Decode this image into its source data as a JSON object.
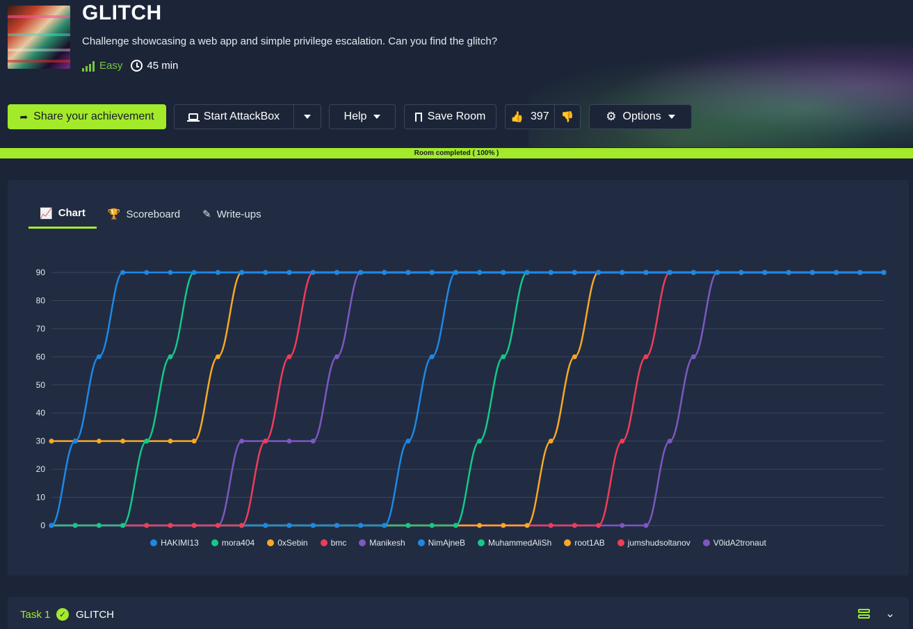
{
  "room": {
    "title": "GLITCH",
    "description": "Challenge showcasing a web app and simple privilege escalation. Can you find the glitch?",
    "difficulty": "Easy",
    "duration": "45 min"
  },
  "toolbar": {
    "share_label": "Share your achievement",
    "attackbox_label": "Start AttackBox",
    "help_label": "Help",
    "save_label": "Save Room",
    "likes": "397",
    "options_label": "Options"
  },
  "progress": {
    "label": "Room completed ( 100% )",
    "percent": 100
  },
  "tabs": [
    {
      "label": "Chart",
      "active": true,
      "icon": "chart-line-icon"
    },
    {
      "label": "Scoreboard",
      "active": false,
      "icon": "trophy-icon"
    },
    {
      "label": "Write-ups",
      "active": false,
      "icon": "pencil-icon"
    }
  ],
  "chart_data": {
    "type": "line",
    "title": "",
    "xlabel": "",
    "ylabel": "",
    "ylim": [
      0,
      90
    ],
    "yticks": [
      0,
      10,
      20,
      30,
      40,
      50,
      60,
      70,
      80,
      90
    ],
    "x": [
      0,
      1,
      2,
      3,
      4,
      5,
      6,
      7,
      8,
      9,
      10,
      11,
      12,
      13,
      14,
      15,
      16,
      17,
      18,
      19,
      20,
      21,
      22,
      23,
      24,
      25,
      26,
      27,
      28,
      29,
      30,
      31,
      32,
      33,
      34,
      35
    ],
    "series": [
      {
        "name": "HAKIMI13",
        "color": "#1e88e5",
        "values": [
          0,
          30,
          60,
          90,
          90,
          90,
          90,
          90,
          90,
          90,
          90,
          90,
          90,
          90,
          90,
          90,
          90,
          90,
          90,
          90,
          90,
          90,
          90,
          90,
          90,
          90,
          90,
          90,
          90,
          90,
          90,
          90,
          90,
          90,
          90,
          90
        ]
      },
      {
        "name": "mora404",
        "color": "#13c98a",
        "values": [
          0,
          0,
          0,
          0,
          30,
          60,
          90,
          90,
          90,
          90,
          90,
          90,
          90,
          90,
          90,
          90,
          90,
          90,
          90,
          90,
          90,
          90,
          90,
          90,
          90,
          90,
          90,
          90,
          90,
          90,
          90,
          90,
          90,
          90,
          90,
          90
        ]
      },
      {
        "name": "0xSebin",
        "color": "#f9a825",
        "values": [
          30,
          30,
          30,
          30,
          30,
          30,
          30,
          60,
          90,
          90,
          90,
          90,
          90,
          90,
          90,
          90,
          90,
          90,
          90,
          90,
          90,
          90,
          90,
          90,
          90,
          90,
          90,
          90,
          90,
          90,
          90,
          90,
          90,
          90,
          90,
          90
        ]
      },
      {
        "name": "bmc",
        "color": "#ef3d59",
        "values": [
          0,
          0,
          0,
          0,
          0,
          0,
          0,
          0,
          0,
          30,
          60,
          90,
          90,
          90,
          90,
          90,
          90,
          90,
          90,
          90,
          90,
          90,
          90,
          90,
          90,
          90,
          90,
          90,
          90,
          90,
          90,
          90,
          90,
          90,
          90,
          90
        ]
      },
      {
        "name": "Manikesh",
        "color": "#7e57c2",
        "values": [
          0,
          0,
          0,
          0,
          0,
          0,
          0,
          0,
          30,
          30,
          30,
          30,
          60,
          90,
          90,
          90,
          90,
          90,
          90,
          90,
          90,
          90,
          90,
          90,
          90,
          90,
          90,
          90,
          90,
          90,
          90,
          90,
          90,
          90,
          90,
          90
        ]
      },
      {
        "name": "NimAjneB",
        "color": "#1e88e5",
        "values": [
          0,
          0,
          0,
          0,
          0,
          0,
          0,
          0,
          0,
          0,
          0,
          0,
          0,
          0,
          0,
          30,
          60,
          90,
          90,
          90,
          90,
          90,
          90,
          90,
          90,
          90,
          90,
          90,
          90,
          90,
          90,
          90,
          90,
          90,
          90,
          90
        ]
      },
      {
        "name": "MuhammedAliSh",
        "color": "#13c98a",
        "values": [
          0,
          0,
          0,
          0,
          0,
          0,
          0,
          0,
          0,
          0,
          0,
          0,
          0,
          0,
          0,
          0,
          0,
          0,
          30,
          60,
          90,
          90,
          90,
          90,
          90,
          90,
          90,
          90,
          90,
          90,
          90,
          90,
          90,
          90,
          90,
          90
        ]
      },
      {
        "name": "root1AB",
        "color": "#f9a825",
        "values": [
          0,
          0,
          0,
          0,
          0,
          0,
          0,
          0,
          0,
          0,
          0,
          0,
          0,
          0,
          0,
          0,
          0,
          0,
          0,
          0,
          0,
          30,
          60,
          90,
          90,
          90,
          90,
          90,
          90,
          90,
          90,
          90,
          90,
          90,
          90,
          90
        ]
      },
      {
        "name": "jumshudsoltanov",
        "color": "#ef3d59",
        "values": [
          0,
          0,
          0,
          0,
          0,
          0,
          0,
          0,
          0,
          0,
          0,
          0,
          0,
          0,
          0,
          0,
          0,
          0,
          0,
          0,
          0,
          0,
          0,
          0,
          30,
          60,
          90,
          90,
          90,
          90,
          90,
          90,
          90,
          90,
          90,
          90
        ]
      },
      {
        "name": "V0idA2tronaut",
        "color": "#7e57c2",
        "values": [
          0,
          0,
          0,
          0,
          0,
          0,
          0,
          0,
          0,
          0,
          0,
          0,
          0,
          0,
          0,
          0,
          0,
          0,
          0,
          0,
          0,
          0,
          0,
          0,
          0,
          0,
          30,
          60,
          90,
          90,
          90,
          90,
          90,
          90,
          90,
          90
        ]
      }
    ],
    "grid": true,
    "legend_placement": "bottom"
  },
  "task": {
    "number_label": "Task 1",
    "title": "GLITCH",
    "completed": true
  }
}
